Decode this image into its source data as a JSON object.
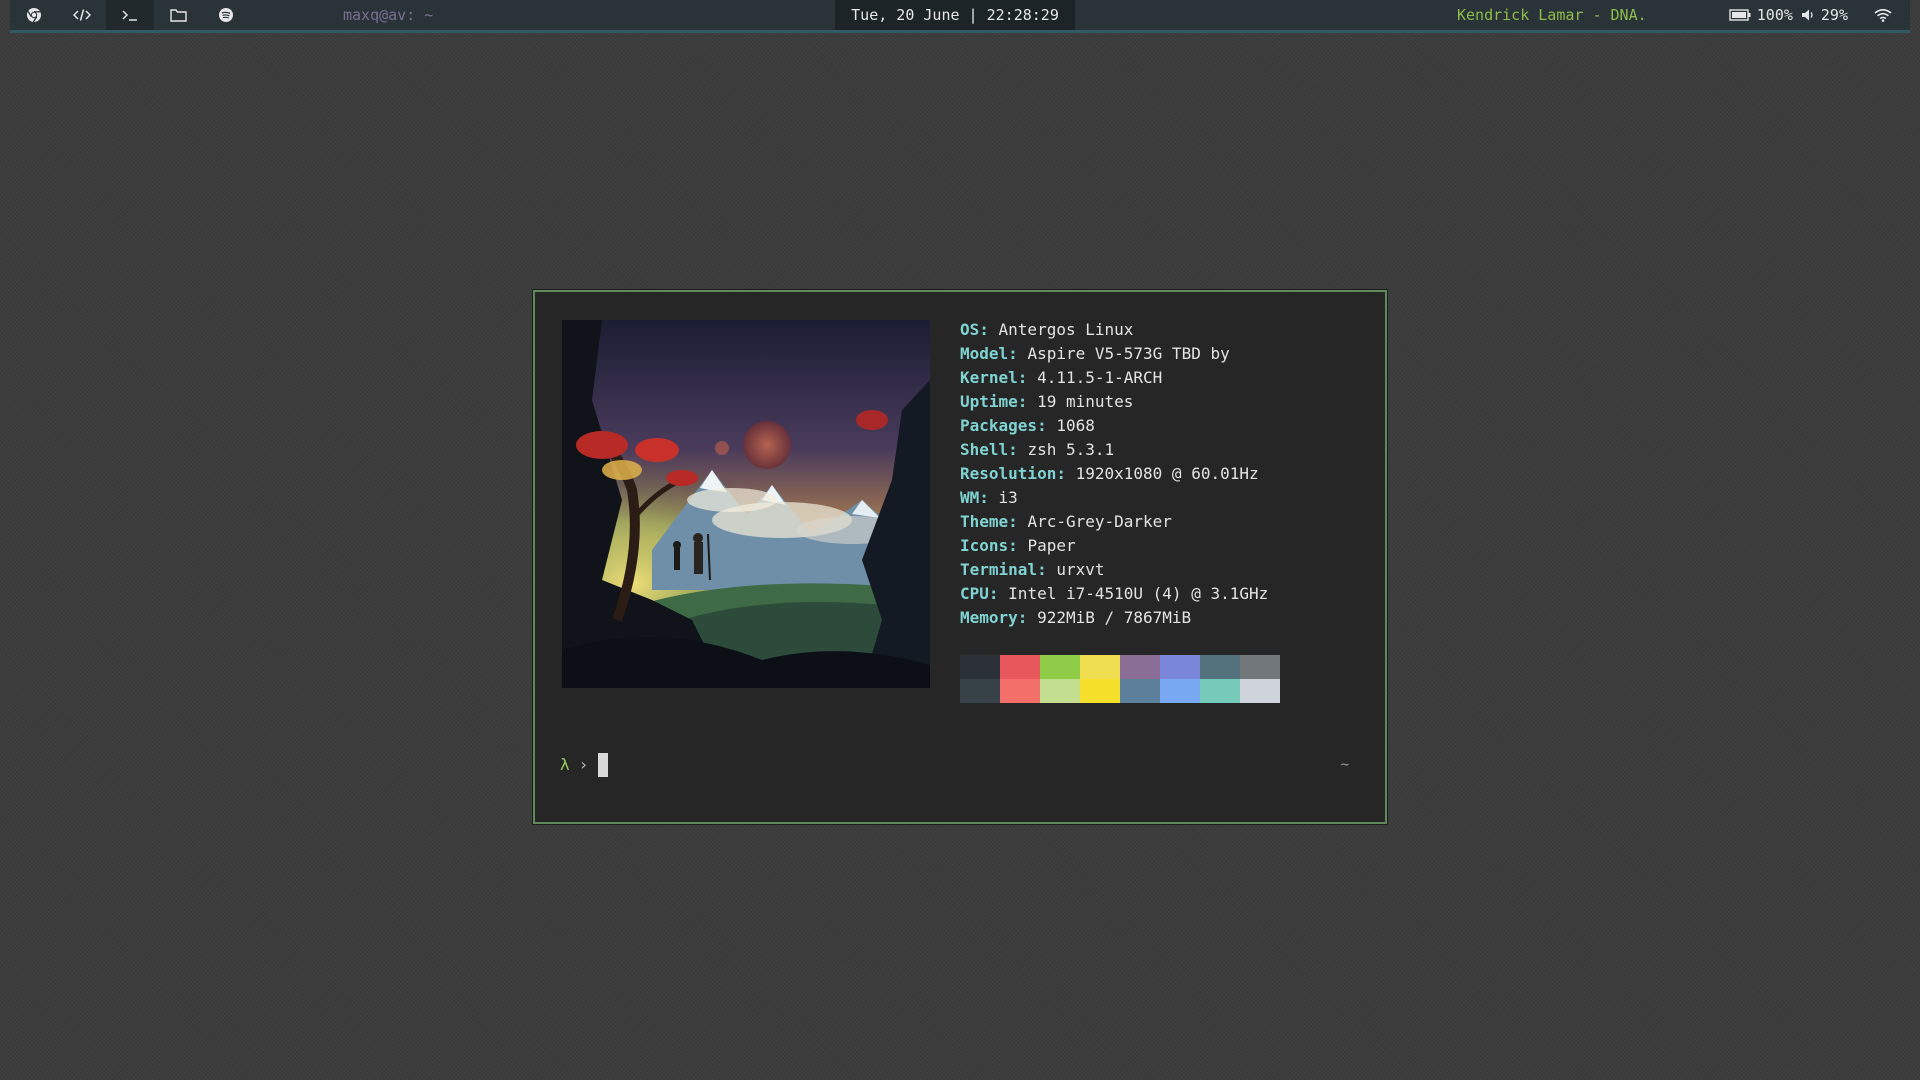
{
  "topbar": {
    "workspaces": [
      {
        "icon": "chrome-icon",
        "active": false
      },
      {
        "icon": "code-icon",
        "active": false
      },
      {
        "icon": "terminal-icon",
        "active": true
      },
      {
        "icon": "folder-icon",
        "active": false
      },
      {
        "icon": "spotify-icon",
        "active": false
      }
    ],
    "window_title": "maxq@av: ~",
    "datetime": "Tue, 20 June | 22:28:29",
    "now_playing": "Kendrick Lamar - DNA.",
    "battery": "100%",
    "volume": "29%",
    "status_icons": [
      "battery-icon",
      "volume-icon",
      "wifi-icon"
    ]
  },
  "terminal": {
    "sysinfo": [
      {
        "key": "OS",
        "value": "Antergos Linux"
      },
      {
        "key": "Model",
        "value": "Aspire V5-573G TBD by"
      },
      {
        "key": "Kernel",
        "value": "4.11.5-1-ARCH"
      },
      {
        "key": "Uptime",
        "value": "19 minutes"
      },
      {
        "key": "Packages",
        "value": "1068"
      },
      {
        "key": "Shell",
        "value": "zsh 5.3.1"
      },
      {
        "key": "Resolution",
        "value": "1920x1080 @ 60.01Hz"
      },
      {
        "key": "WM",
        "value": "i3"
      },
      {
        "key": "Theme",
        "value": "Arc-Grey-Darker"
      },
      {
        "key": "Icons",
        "value": "Paper"
      },
      {
        "key": "Terminal",
        "value": "urxvt"
      },
      {
        "key": "CPU",
        "value": "Intel i7-4510U (4) @ 3.1GHz"
      },
      {
        "key": "Memory",
        "value": "922MiB / 7867MiB"
      }
    ],
    "palette": {
      "normal": [
        "#2b3136",
        "#e8575c",
        "#8fcc47",
        "#eedd4f",
        "#8a6e95",
        "#7a86d8",
        "#52727d",
        "#71777b"
      ],
      "bright": [
        "#384349",
        "#f27069",
        "#c3de8f",
        "#f6df2b",
        "#5c7f9b",
        "#79a8f2",
        "#75cab9",
        "#cfd3db"
      ]
    },
    "prompt": {
      "symbol": "λ",
      "arrow": "›",
      "right": "~"
    }
  },
  "colors": {
    "border": "#5f8a5a",
    "key": "#7fd3d2",
    "song": "#8dbd4b"
  }
}
